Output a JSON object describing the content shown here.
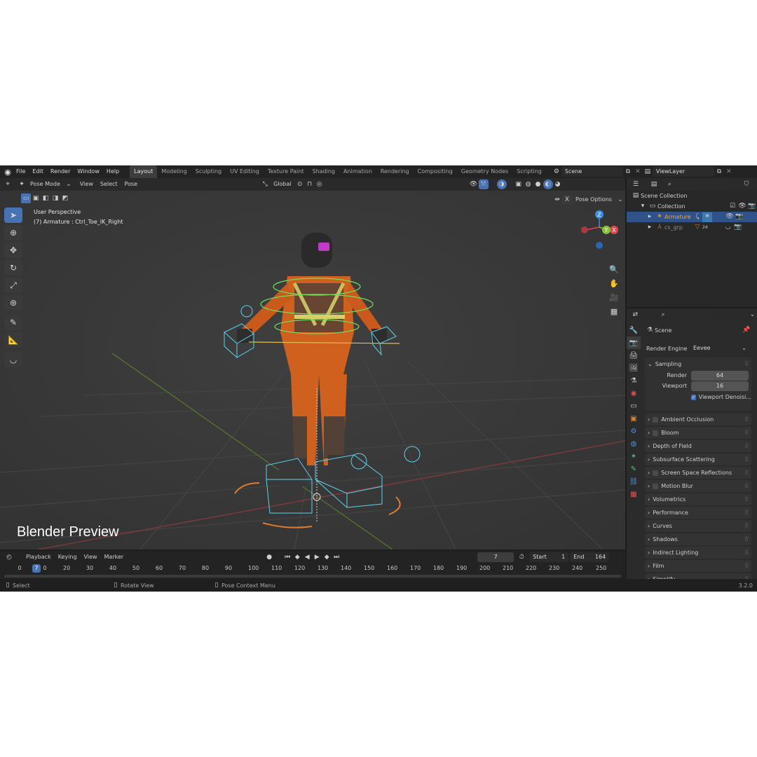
{
  "menu": {
    "items": [
      "File",
      "Edit",
      "Render",
      "Window",
      "Help"
    ],
    "workspaces": [
      "Layout",
      "Modeling",
      "Sculpting",
      "UV Editing",
      "Texture Paint",
      "Shading",
      "Animation",
      "Rendering",
      "Compositing",
      "Geometry Nodes",
      "Scripting"
    ],
    "active_workspace": "Layout",
    "scene_name": "Scene",
    "view_layer": "ViewLayer"
  },
  "viewport": {
    "mode": "Pose Mode",
    "menus": [
      "View",
      "Select",
      "Pose"
    ],
    "transform_orientation": "Global",
    "pose_options": "Pose Options",
    "overlay_title": "User Perspective",
    "overlay_subtitle": "(7) Armature : Ctrl_Toe_IK_Right",
    "watermark": "Blender Preview",
    "gizmo": {
      "z": "Z",
      "y": "Y",
      "x": "X"
    }
  },
  "outliner": {
    "root": "Scene Collection",
    "collection": "Collection",
    "items": [
      {
        "name": "Armature",
        "selected": true
      },
      {
        "name": "cs_grp",
        "selected": false,
        "count": "24"
      }
    ]
  },
  "properties": {
    "scene_label": "Scene",
    "render_engine_label": "Render Engine",
    "render_engine": "Eevee",
    "sampling": {
      "title": "Sampling",
      "render_label": "Render",
      "render_value": "64",
      "viewport_label": "Viewport",
      "viewport_value": "16",
      "denoise_label": "Viewport Denoisi..."
    },
    "panels": [
      {
        "label": "Ambient Occlusion",
        "checkbox": true
      },
      {
        "label": "Bloom",
        "checkbox": true
      },
      {
        "label": "Depth of Field",
        "checkbox": false
      },
      {
        "label": "Subsurface Scattering",
        "checkbox": false
      },
      {
        "label": "Screen Space Reflections",
        "checkbox": true
      },
      {
        "label": "Motion Blur",
        "checkbox": true
      },
      {
        "label": "Volumetrics",
        "checkbox": false
      },
      {
        "label": "Performance",
        "checkbox": false
      },
      {
        "label": "Curves",
        "checkbox": false
      },
      {
        "label": "Shadows",
        "checkbox": false
      },
      {
        "label": "Indirect Lighting",
        "checkbox": false
      },
      {
        "label": "Film",
        "checkbox": false
      },
      {
        "label": "Simplify",
        "checkbox": false
      }
    ]
  },
  "timeline": {
    "menus": [
      "Playback",
      "Keying",
      "View",
      "Marker"
    ],
    "current_frame": "7",
    "start_label": "Start",
    "start_value": "1",
    "end_label": "End",
    "end_value": "164",
    "ruler": [
      "0",
      "7",
      "0",
      "20",
      "30",
      "40",
      "50",
      "60",
      "70",
      "80",
      "90",
      "100",
      "110",
      "120",
      "130",
      "140",
      "150",
      "160",
      "170",
      "180",
      "190",
      "200",
      "210",
      "220",
      "230",
      "240",
      "250"
    ]
  },
  "status": {
    "select": "Select",
    "rotate": "Rotate View",
    "context": "Pose Context Menu",
    "version": "3.2.0"
  },
  "colors": {
    "accent": "#4772b3",
    "selected_row": "#2f5288",
    "bone_cyan": "#5fd0ee",
    "bone_green": "#6ee05a",
    "orange_suit": "#d8621c",
    "gizmo_x": "#e04452",
    "gizmo_y": "#86c33a",
    "gizmo_z": "#3c8ce6"
  }
}
